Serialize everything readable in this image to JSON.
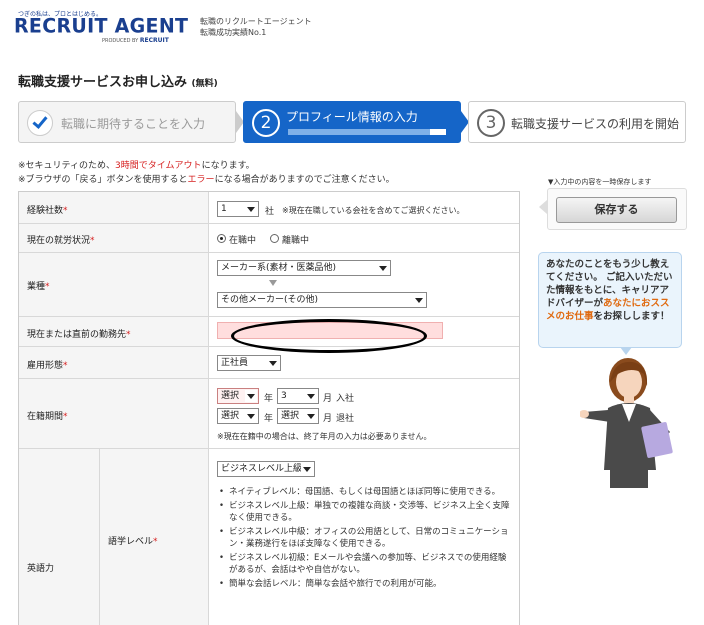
{
  "header": {
    "tagline": "つぎの私は、プロとはじめる。",
    "logo": "RECRUIT AGENT",
    "produced_by": "PRODUCED BY",
    "produced_brand": "RECRUIT",
    "sub1": "転職のリクルートエージェント",
    "sub2": "転職成功実績No.1"
  },
  "page": {
    "title": "転職支援サービスお申し込み",
    "title_note": "(無料)"
  },
  "steps": [
    {
      "label": "転職に期待することを入力"
    },
    {
      "number": "2",
      "label": "プロフィール情報の入力",
      "progress": 0.9
    },
    {
      "number": "3",
      "label": "転職支援サービスの利用を開始"
    }
  ],
  "notices": {
    "line1_a": "※セキュリティのため、",
    "line1_red": "3時間でタイムアウト",
    "line1_b": "になります。",
    "line2_a": "※ブラウザの「戻る」ボタンを使用すると",
    "line2_red": "エラー",
    "line2_b": "になる場合がありますのでご注意ください。"
  },
  "required_mark": "*",
  "form": {
    "companies": {
      "label": "経験社数",
      "value": "1",
      "unit": "社",
      "note": "※現在在職している会社を含めてご選択ください。"
    },
    "employment_status": {
      "label": "現在の就労状況",
      "option1": "在職中",
      "option2": "離職中"
    },
    "industry": {
      "label": "業種",
      "value1": "メーカー系(素材・医薬品他)",
      "value2": "その他メーカー(その他)"
    },
    "company": {
      "label": "現在または直前の勤務先"
    },
    "employment_type": {
      "label": "雇用形態",
      "value": "正社員"
    },
    "tenure": {
      "label": "在籍期間",
      "start_year": "選択",
      "year_label": "年",
      "start_month": "3",
      "month_label": "月",
      "join_label": "入社",
      "end_year": "選択",
      "end_month": "選択",
      "leave_label": "退社",
      "note": "※現在在籍中の場合は、終了年月の入力は必要ありません。"
    },
    "english": {
      "label": "英語力",
      "sub_label": "語学レベル",
      "value": "ビジネスレベル上級",
      "bullets": [
        "ネイティブレベル：母国語、もしくは母国語とほぼ同等に使用できる。",
        "ビジネスレベル上級：単独での複雑な商談・交渉等、ビジネス上全く支障なく使用できる。",
        "ビジネスレベル中級：オフィスの公用語として、日常のコミュニケーション・業務遂行をほぼ支障なく使用できる。",
        "ビジネスレベル初級：Eメールや会議への参加等、ビジネスでの使用経験があるが、会話はやや自信がない。",
        "簡単な会話レベル：簡単な会話や旅行での利用が可能。"
      ]
    }
  },
  "sidebar": {
    "save_note": "▼入力中の内容を一時保存します",
    "save_label": "保存する",
    "bubble_a": "あなたのことをもう少し教えてください。",
    "bubble_b": "ご記入いただいた情報をもとに、キャリアアドバイザーが",
    "bubble_orange1": "あなたにおススメの",
    "bubble_orange2": "お仕事",
    "bubble_c": "をお探しします！"
  },
  "colors": {
    "brand_blue": "#1a3f8f",
    "step_active": "#1565c8",
    "required_red": "#d62020",
    "highlight_orange": "#e06a10",
    "input_error_bg": "#ffdede"
  }
}
